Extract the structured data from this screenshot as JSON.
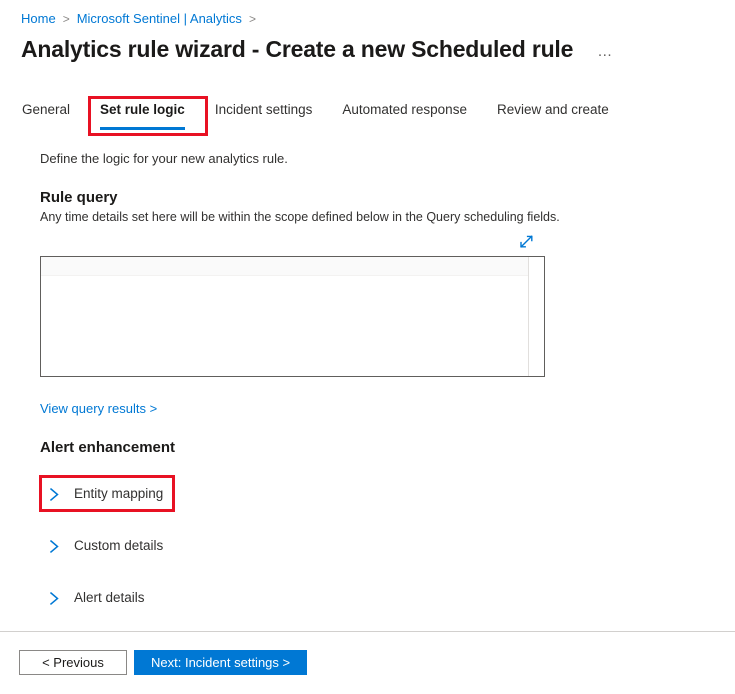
{
  "breadcrumb": {
    "items": [
      {
        "label": "Home",
        "separator": ">"
      },
      {
        "label": "Microsoft Sentinel | Analytics",
        "separator": ">"
      }
    ],
    "sep0": ">",
    "sep1": ">"
  },
  "header": {
    "title": "Analytics rule wizard - Create a new Scheduled rule",
    "more_menu": "…",
    "more_menu_name": "more-options-icon"
  },
  "tabs": [
    {
      "label": "General",
      "selected": false
    },
    {
      "label": "Set rule logic",
      "selected": true
    },
    {
      "label": "Incident settings",
      "selected": false
    },
    {
      "label": "Automated response",
      "selected": false
    },
    {
      "label": "Review and create",
      "selected": false
    }
  ],
  "main": {
    "intro": "Define the logic for your new analytics rule.",
    "rule_query": {
      "heading": "Rule query",
      "subheading": "Any time details set here will be within the scope defined below in the Query scheduling fields.",
      "expand_icon": "expand-diagonal-icon",
      "editor_value": "",
      "editor_placeholder": ""
    },
    "view_query_results_link": "View query results >",
    "alert_enhancement": {
      "heading": "Alert enhancement",
      "rows": [
        {
          "label": "Entity mapping",
          "icon": "chevron-right-icon",
          "expanded": false,
          "highlighted": true
        },
        {
          "label": "Custom details",
          "icon": "chevron-right-icon",
          "expanded": false,
          "highlighted": false
        },
        {
          "label": "Alert details",
          "icon": "chevron-right-icon",
          "expanded": false,
          "highlighted": false
        }
      ]
    }
  },
  "footer": {
    "previous_label": "< Previous",
    "next_label": "Next: Incident settings >"
  },
  "colors": {
    "accent_blue": "#0078d4",
    "link_blue": "#0078d4",
    "highlight_red": "#e81123",
    "text_primary": "#323130",
    "text_heading": "#1b1a19",
    "border_gray": "#605e5c"
  }
}
